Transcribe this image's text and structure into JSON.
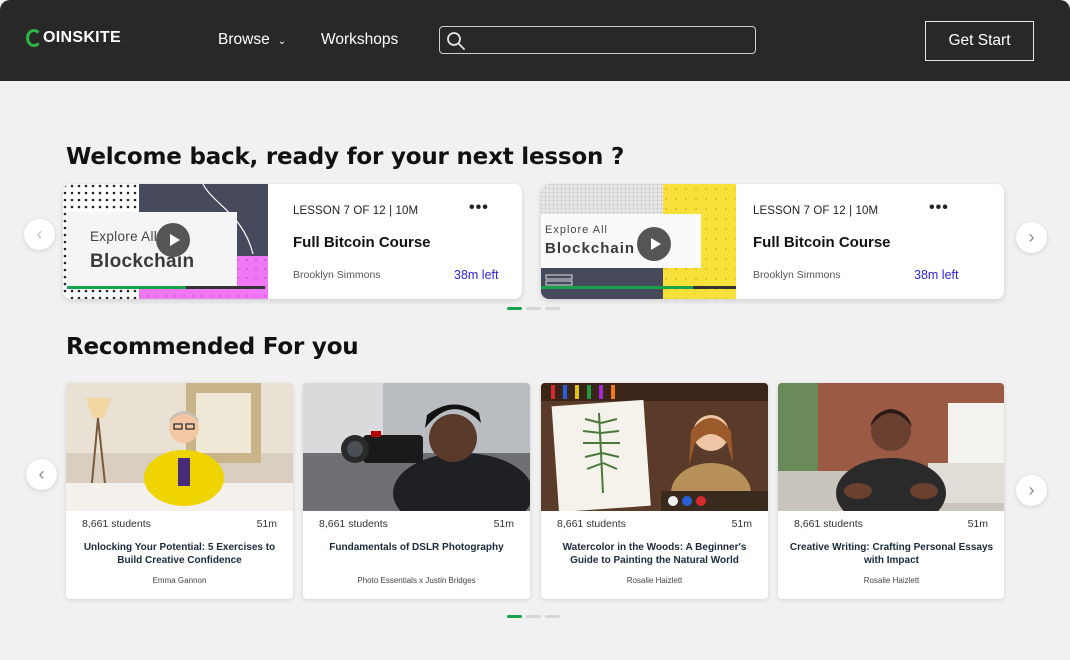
{
  "nav": {
    "logo_text": "OINSKITE",
    "browse_label": "Browse",
    "workshops_label": "Workshops",
    "search_placeholder": "",
    "get_start_label": "Get Start"
  },
  "welcome": {
    "title": "Welcome back, ready for your next lesson ?",
    "lessons": [
      {
        "thumb_line1": "Explore All",
        "thumb_line2": "Blockchain",
        "meta": "LESSON 7 OF 12 | 10M",
        "title": "Full Bitcoin Course",
        "author": "Brooklyn Simmons",
        "time_left": "38m left",
        "progress": 0.6
      },
      {
        "thumb_line1": "Explore All",
        "thumb_line2": "Blockchain",
        "meta": "LESSON 7 OF 12 | 10M",
        "title": "Full Bitcoin Course",
        "author": "Brooklyn Simmons",
        "time_left": "38m left",
        "progress": 0.78
      }
    ]
  },
  "recommended": {
    "title": "Recommended For you",
    "courses": [
      {
        "students": "8,661 students",
        "duration": "51m",
        "title": "Unlocking Your Potential: 5 Exercises to Build Creative Confidence",
        "author": "Emma Gannon"
      },
      {
        "students": "8,661 students",
        "duration": "51m",
        "title": "Fundamentals of DSLR Photography",
        "author": "Photo Essentials x Justin Bridges"
      },
      {
        "students": "8,661 students",
        "duration": "51m",
        "title": "Watercolor in the Woods: A Beginner's Guide to Painting the Natural World",
        "author": "Rosalie Haizlett"
      },
      {
        "students": "8,661 students",
        "duration": "51m",
        "title": "Creative Writing: Crafting Personal Essays with Impact",
        "author": "Rosalie Haizlett"
      }
    ]
  },
  "colors": {
    "nav_bg": "#282828",
    "accent_green": "#16a34a",
    "time_left_blue": "#2c26d9",
    "page_bg": "#f1f1f1"
  }
}
